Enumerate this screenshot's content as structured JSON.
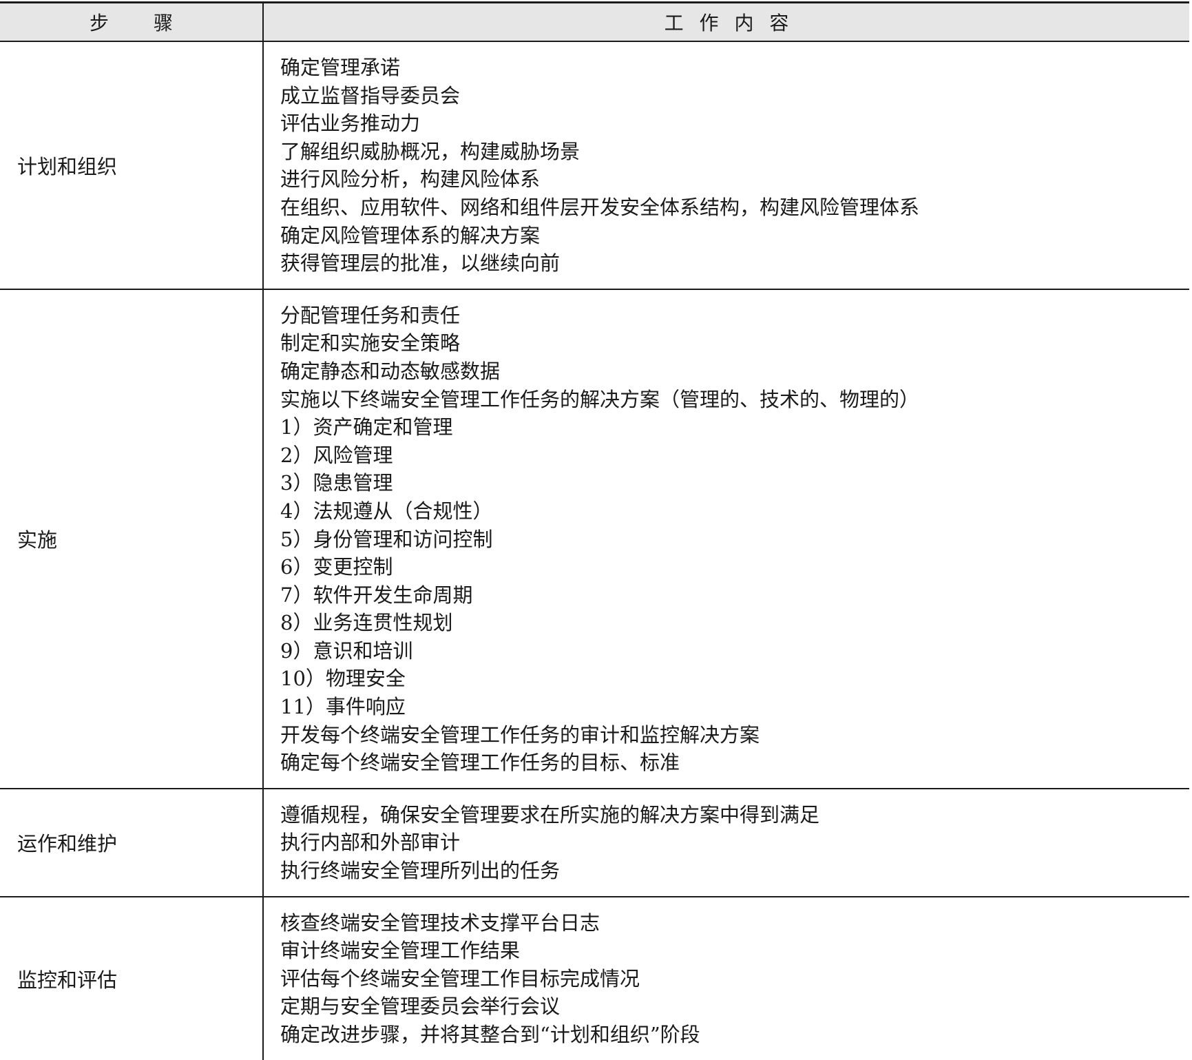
{
  "header": {
    "step_label": "步 骤",
    "content_label": "工 作 内 容"
  },
  "rows": [
    {
      "step": "计划和组织",
      "items": [
        "确定管理承诺",
        "成立监督指导委员会",
        "评估业务推动力",
        "了解组织威胁概况，构建威胁场景",
        "进行风险分析，构建风险体系",
        "在组织、应用软件、网络和组件层开发安全体系结构，构建风险管理体系",
        "确定风险管理体系的解决方案",
        "获得管理层的批准，以继续向前"
      ]
    },
    {
      "step": "实施",
      "items": [
        "分配管理任务和责任",
        "制定和实施安全策略",
        "确定静态和动态敏感数据",
        "实施以下终端安全管理工作任务的解决方案（管理的、技术的、物理的）",
        "1）资产确定和管理",
        "2）风险管理",
        "3）隐患管理",
        "4）法规遵从（合规性）",
        "5）身份管理和访问控制",
        "6）变更控制",
        "7）软件开发生命周期",
        "8）业务连贯性规划",
        "9）意识和培训",
        "10）物理安全",
        "11）事件响应",
        "开发每个终端安全管理工作任务的审计和监控解决方案",
        "确定每个终端安全管理工作任务的目标、标准"
      ]
    },
    {
      "step": "运作和维护",
      "items": [
        "遵循规程，确保安全管理要求在所实施的解决方案中得到满足",
        "执行内部和外部审计",
        "执行终端安全管理所列出的任务"
      ]
    },
    {
      "step": "监控和评估",
      "items": [
        "核查终端安全管理技术支撑平台日志",
        "审计终端安全管理工作结果",
        "评估每个终端安全管理工作目标完成情况",
        "定期与安全管理委员会举行会议",
        "确定改进步骤，并将其整合到“计划和组织”阶段"
      ]
    }
  ]
}
